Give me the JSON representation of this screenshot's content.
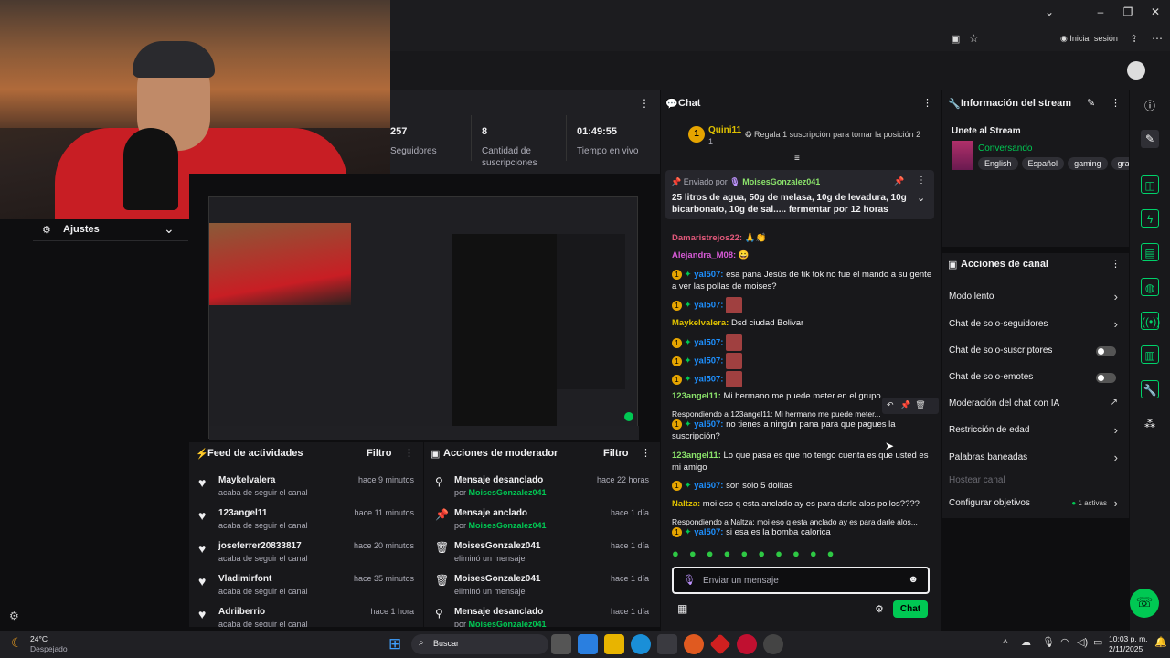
{
  "browser": {
    "signin_label": "Iniciar sesión"
  },
  "settings": {
    "label": "Ajustes"
  },
  "stats": {
    "followers_value": "257",
    "followers_label": "Seguidores",
    "subs_value": "8",
    "subs_label": "Cantidad de suscripciones",
    "uptime_value": "01:49:55",
    "uptime_label": "Tiempo en vivo"
  },
  "feed": {
    "title": "Feed de actividades",
    "filter": "Filtro",
    "items": [
      {
        "name": "Maykelvalera",
        "action": "acaba de seguir el canal",
        "time": "hace 9 minutos"
      },
      {
        "name": "123angel11",
        "action": "acaba de seguir el canal",
        "time": "hace 11 minutos"
      },
      {
        "name": "joseferrer20833817",
        "action": "acaba de seguir el canal",
        "time": "hace 20 minutos"
      },
      {
        "name": "Vladimirfont",
        "action": "acaba de seguir el canal",
        "time": "hace 35 minutos"
      },
      {
        "name": "Adriiberrio",
        "action": "acaba de seguir el canal",
        "time": "hace 1 hora"
      }
    ]
  },
  "modactions": {
    "title": "Acciones de moderador",
    "filter": "Filtro",
    "items": [
      {
        "action": "Mensaje desanclado",
        "by": "por",
        "who": "MoisesGonzalez041",
        "time": "hace 22 horas"
      },
      {
        "action": "Mensaje anclado",
        "by": "por",
        "who": "MoisesGonzalez041",
        "time": "hace 1 día"
      },
      {
        "action": "MoisesGonzalez041",
        "by": "eliminó un mensaje",
        "who": "",
        "time": "hace 1 día"
      },
      {
        "action": "MoisesGonzalez041",
        "by": "eliminó un mensaje",
        "who": "",
        "time": "hace 1 día"
      },
      {
        "action": "Mensaje desanclado",
        "by": "por",
        "who": "MoisesGonzalez041",
        "time": "hace 1 día"
      }
    ]
  },
  "chat": {
    "title": "Chat",
    "top_user": "Quini11",
    "top_rank": "1",
    "top_promo": "Regala 1 suscripción para tomar la posición 2",
    "pinned_by_label": "Enviado por",
    "pinned_by": "MoisesGonzalez041",
    "pinned_text": "25 litros de agua, 50g de melasa, 10g de levadura, 10g bicarbonato, 10g de sal..... fermentar por 12 horas",
    "messages": [
      {
        "user": "Damaristrejos22:",
        "text": ""
      },
      {
        "user": "Alejandra_M08:",
        "text": ""
      },
      {
        "user": "yal507:",
        "text": "esa pana Jesús de tik tok no fue el mando a su gente a ver las pollas de moises?"
      },
      {
        "user": "yal507:",
        "text": ""
      },
      {
        "user": "Maykelvalera:",
        "text": "Dsd ciudad Bolivar"
      },
      {
        "user": "yal507:",
        "text": ""
      },
      {
        "user": "yal507:",
        "text": ""
      },
      {
        "user": "yal507:",
        "text": ""
      },
      {
        "user": "123angel11:",
        "text": "Mi hermano me puede meter en el grupo"
      },
      {
        "reply": "Respondiendo a 123angel11: Mi hermano me puede meter...",
        "user": "yal507:",
        "text": "no tienes a ningún pana para que pagues la suscripción?"
      },
      {
        "user": "123angel11:",
        "text": "Lo que pasa es que no tengo cuenta es que usted es mi amigo"
      },
      {
        "user": "yal507:",
        "text": "son solo 5 dolitas"
      },
      {
        "user": "Naltza:",
        "text": "moi eso q esta anclado ay es para darle alos pollos????"
      },
      {
        "reply": "Respondiendo a Naltza: moi eso q esta anclado ay es para darle alos...",
        "user": "yal507:",
        "text": "si esa es la bomba calorica"
      }
    ],
    "input_placeholder": "Enviar un mensaje",
    "send_label": "Chat"
  },
  "stream_info": {
    "title": "Información del stream",
    "headline": "Unete al Stream",
    "category": "Conversando",
    "tags": [
      "English",
      "Español",
      "gaming",
      "gra"
    ]
  },
  "channel_actions": {
    "title": "Acciones de canal",
    "items": [
      {
        "label": "Modo lento",
        "kind": "chevron"
      },
      {
        "label": "Chat de solo-seguidores",
        "kind": "chevron"
      },
      {
        "label": "Chat de solo-suscriptores",
        "kind": "toggle"
      },
      {
        "label": "Chat de solo-emotes",
        "kind": "toggle"
      },
      {
        "label": "Moderación del chat con IA",
        "kind": "external"
      },
      {
        "label": "Restricción de edad",
        "kind": "chevron"
      },
      {
        "label": "Palabras baneadas",
        "kind": "chevron"
      },
      {
        "label": "Hostear canal",
        "kind": "disabled"
      },
      {
        "label": "Configurar objetivos",
        "kind": "chevron",
        "extra": "1 activas"
      }
    ]
  },
  "taskbar": {
    "weather_temp": "24°C",
    "weather_desc": "Despejado",
    "search": "Buscar",
    "time": "10:03 p. m.",
    "date": "2/11/2025"
  },
  "colors": {
    "accent": "#00c853",
    "bg": "#0e0e10",
    "panel": "#18181b"
  }
}
